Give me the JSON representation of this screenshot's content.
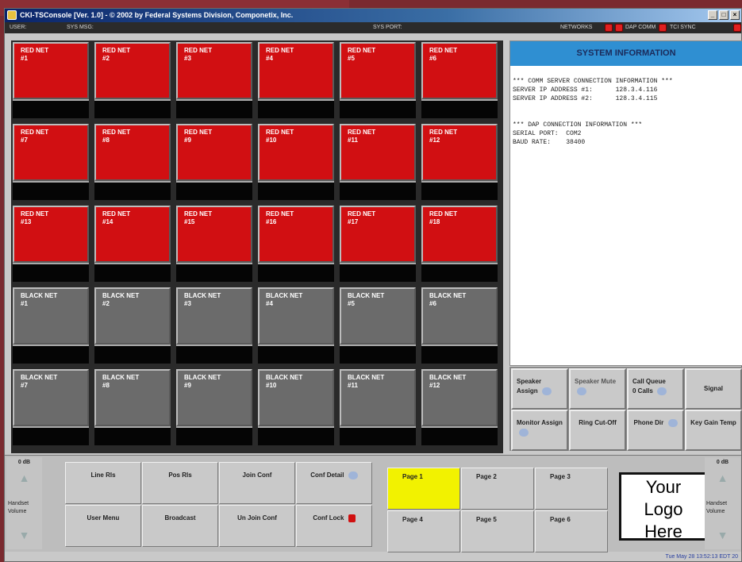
{
  "window": {
    "title": "CKI-TSConsole [Ver. 1.0] - © 2002 by Federal Systems Division, Componetix, Inc.",
    "controls": [
      "_",
      "□",
      "×"
    ]
  },
  "statusbar": {
    "user_label": "USER:",
    "sysmsg_label": "SYS MSG:",
    "sysport_label": "SYS PORT:",
    "networks_label": "NETWORKS",
    "dapcomm_label": "DAP COMM",
    "tcisync_label": "TCI SYNC",
    "led_color": "#e02020"
  },
  "nets": [
    {
      "type": "red",
      "label": "RED NET",
      "num": "#1"
    },
    {
      "type": "red",
      "label": "RED NET",
      "num": "#2"
    },
    {
      "type": "red",
      "label": "RED NET",
      "num": "#3"
    },
    {
      "type": "red",
      "label": "RED NET",
      "num": "#4"
    },
    {
      "type": "red",
      "label": "RED NET",
      "num": "#5"
    },
    {
      "type": "red",
      "label": "RED NET",
      "num": "#6"
    },
    {
      "type": "red",
      "label": "RED NET",
      "num": "#7"
    },
    {
      "type": "red",
      "label": "RED NET",
      "num": "#8"
    },
    {
      "type": "red",
      "label": "RED NET",
      "num": "#9"
    },
    {
      "type": "red",
      "label": "RED NET",
      "num": "#10"
    },
    {
      "type": "red",
      "label": "RED NET",
      "num": "#11"
    },
    {
      "type": "red",
      "label": "RED NET",
      "num": "#12"
    },
    {
      "type": "red",
      "label": "RED NET",
      "num": "#13"
    },
    {
      "type": "red",
      "label": "RED NET",
      "num": "#14"
    },
    {
      "type": "red",
      "label": "RED NET",
      "num": "#15"
    },
    {
      "type": "red",
      "label": "RED NET",
      "num": "#16"
    },
    {
      "type": "red",
      "label": "RED NET",
      "num": "#17"
    },
    {
      "type": "red",
      "label": "RED NET",
      "num": "#18"
    },
    {
      "type": "black",
      "label": "BLACK NET",
      "num": "#1"
    },
    {
      "type": "black",
      "label": "BLACK NET",
      "num": "#2"
    },
    {
      "type": "black",
      "label": "BLACK NET",
      "num": "#3"
    },
    {
      "type": "black",
      "label": "BLACK NET",
      "num": "#4"
    },
    {
      "type": "black",
      "label": "BLACK NET",
      "num": "#5"
    },
    {
      "type": "black",
      "label": "BLACK NET",
      "num": "#6"
    },
    {
      "type": "black",
      "label": "BLACK NET",
      "num": "#7"
    },
    {
      "type": "black",
      "label": "BLACK NET",
      "num": "#8"
    },
    {
      "type": "black",
      "label": "BLACK NET",
      "num": "#9"
    },
    {
      "type": "black",
      "label": "BLACK NET",
      "num": "#10"
    },
    {
      "type": "black",
      "label": "BLACK NET",
      "num": "#11"
    },
    {
      "type": "black",
      "label": "BLACK NET",
      "num": "#12"
    }
  ],
  "sysinfo": {
    "title": "SYSTEM INFORMATION",
    "body": "*** COMM SERVER CONNECTION INFORMATION ***\nSERVER IP ADDRESS #1:      128.3.4.116\nSERVER IP ADDRESS #2:      128.3.4.115\n\n\n*** DAP CONNECTION INFORMATION ***\nSERIAL PORT:  COM2\nBAUD RATE:    38400"
  },
  "right_buttons": {
    "speaker_assign": "Speaker Assign",
    "speaker_mute": "Speaker Mute",
    "call_queue": "Call Queue",
    "call_queue_count": "0 Calls",
    "signal": "Signal",
    "monitor_assign": "Monitor Assign",
    "ring_cutoff": "Ring Cut-Off",
    "phone_dir": "Phone Dir",
    "key_gain_temp": "Key Gain Temp"
  },
  "volume": {
    "left_db": "0 dB",
    "right_db": "0 dB",
    "left_label": "Handset Volume",
    "right_label": "Handset Volume"
  },
  "controls": {
    "line_rls": "Line Rls",
    "pos_rls": "Pos Rls",
    "join_conf": "Join Conf",
    "conf_detail": "Conf Detail",
    "user_menu": "User Menu",
    "broadcast": "Broadcast",
    "unjoin_conf": "Un Join Conf",
    "conf_lock": "Conf Lock"
  },
  "pages": [
    "Page 1",
    "Page 2",
    "Page 3",
    "Page 4",
    "Page 5",
    "Page 6"
  ],
  "active_page": "Page 1",
  "logo": {
    "line1": "Your",
    "line2": "Logo",
    "line3": "Here"
  },
  "footer": {
    "datetime": "Tue May 28 13:52:13 EDT 20"
  }
}
